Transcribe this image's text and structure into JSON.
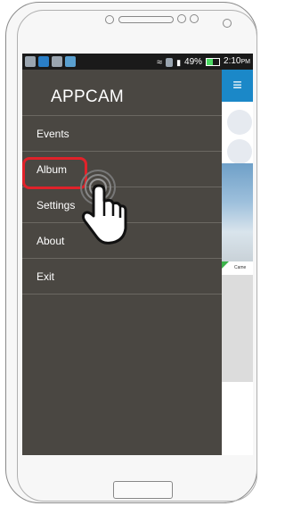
{
  "status_bar": {
    "signal_text": "49%",
    "time": "2:10",
    "time_suffix": "PM"
  },
  "drawer": {
    "title": "APPCAM",
    "items": [
      {
        "label": "Events"
      },
      {
        "label": "Album"
      },
      {
        "label": "Settings"
      },
      {
        "label": "About"
      },
      {
        "label": "Exit"
      }
    ],
    "highlighted_item": "Album"
  },
  "background_app": {
    "menu_icon": "hamburger-icon",
    "card_label": "Came"
  },
  "colors": {
    "drawer_bg": "#4a4742",
    "highlight": "#e0222a",
    "appbar": "#1b88c8"
  }
}
